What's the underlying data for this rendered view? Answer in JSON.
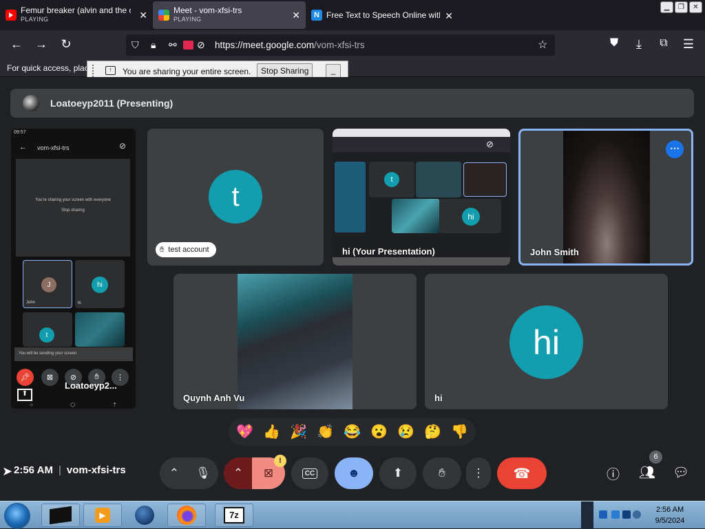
{
  "browser": {
    "tabs": [
      {
        "title": "Femur breaker (alvin and the ch",
        "status": "PLAYING"
      },
      {
        "title": "Meet - vom-xfsi-trs",
        "status": "PLAYING"
      },
      {
        "title": "Free Text to Speech Online with",
        "status": ""
      }
    ],
    "url_host": "https://meet.google.com",
    "url_path": "/vom-xfsi-trs",
    "bookmarks_text": "For quick access, plac"
  },
  "share_bar": {
    "message": "You are sharing your entire screen.",
    "stop_label": "Stop Sharing",
    "min_label": "_"
  },
  "meet": {
    "presenter_label": "Loatoeyp2011 (Presenting)",
    "tiles": {
      "phone": {
        "status_time": "09:57",
        "room": "vom-xfsi-trs",
        "sharing_line": "You're sharing your screen with everyone",
        "stop_sharing": "Stop sharing",
        "mini_john": "John",
        "mini_hi": "hi",
        "toast": "You will be sending your screen",
        "name": "Loatoeyp2..."
      },
      "test_account": {
        "initial": "t",
        "name": "test account"
      },
      "presentation": {
        "name": "hi (Your Presentation)",
        "mini_t": "t",
        "mini_hi": "hi"
      },
      "john": {
        "name": "John Smith"
      },
      "quynh": {
        "name": "Quynh Anh Vu"
      },
      "hi": {
        "initial": "hi",
        "name": "hi"
      }
    },
    "reactions": [
      "💖",
      "👍",
      "🎉",
      "👏",
      "😂",
      "😮",
      "😢",
      "🤔",
      "👎"
    ],
    "time": "2:56 AM",
    "meeting_code": "vom-xfsi-trs",
    "participant_count": "6",
    "warning_mark": "!",
    "captions_label": "CC"
  },
  "taskbar": {
    "clock_time": "2:56 AM",
    "clock_date": "9/5/2024",
    "items": [
      "terminal",
      "media-player",
      "globe",
      "firefox",
      "7zip"
    ],
    "zip_label": "7z"
  },
  "colors": {
    "meet_bg": "#202124",
    "tile_bg": "#3c4043",
    "avatar_teal": "#129eaf",
    "end_call_red": "#ea4335",
    "active_blue": "#8ab4f8"
  }
}
